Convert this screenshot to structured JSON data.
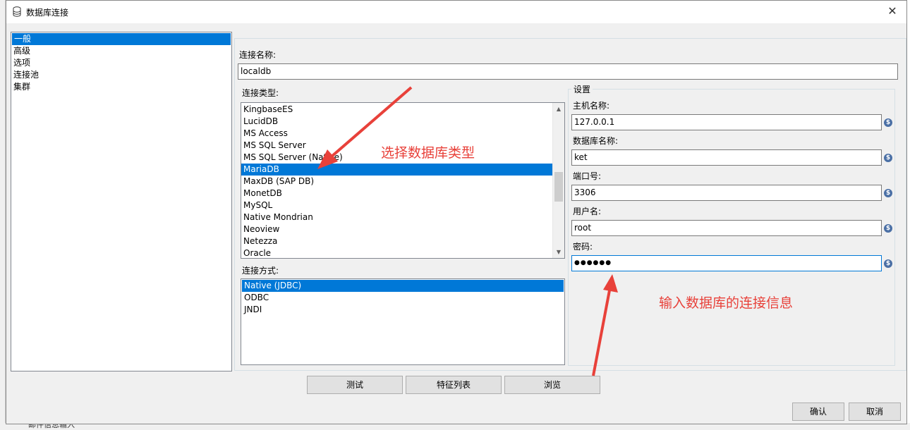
{
  "window": {
    "title": "数据库连接"
  },
  "nav": {
    "items": [
      "一般",
      "高级",
      "选项",
      "连接池",
      "集群"
    ],
    "selected_index": 0
  },
  "connection_name": {
    "label": "连接名称:",
    "value": "localdb"
  },
  "connection_type": {
    "label": "连接类型:",
    "items": [
      "KingbaseES",
      "LucidDB",
      "MS Access",
      "MS SQL Server",
      "MS SQL Server (Native)",
      "MariaDB",
      "MaxDB (SAP DB)",
      "MonetDB",
      "MySQL",
      "Native Mondrian",
      "Neoview",
      "Netezza",
      "Oracle"
    ],
    "selected": "MariaDB"
  },
  "access_method": {
    "label": "连接方式:",
    "items": [
      "Native (JDBC)",
      "ODBC",
      "JNDI"
    ],
    "selected": "Native (JDBC)"
  },
  "settings": {
    "title": "设置",
    "host_label": "主机名称:",
    "host_value": "127.0.0.1",
    "db_label": "数据库名称:",
    "db_value": "ket",
    "port_label": "端口号:",
    "port_value": "3306",
    "user_label": "用户名:",
    "user_value": "root",
    "password_label": "密码:",
    "password_value": "●●●●●●",
    "variable_icon": "$"
  },
  "buttons": {
    "test": "测试",
    "features": "特征列表",
    "browse": "浏览",
    "ok": "确认",
    "cancel": "取消"
  },
  "annotations": {
    "select_type": "选择数据库类型",
    "enter_info": "输入数据库的连接信息"
  },
  "background": {
    "status_text": "邮件信息输入"
  },
  "colors": {
    "selection": "#0078d7",
    "annotation": "#e8413a"
  }
}
